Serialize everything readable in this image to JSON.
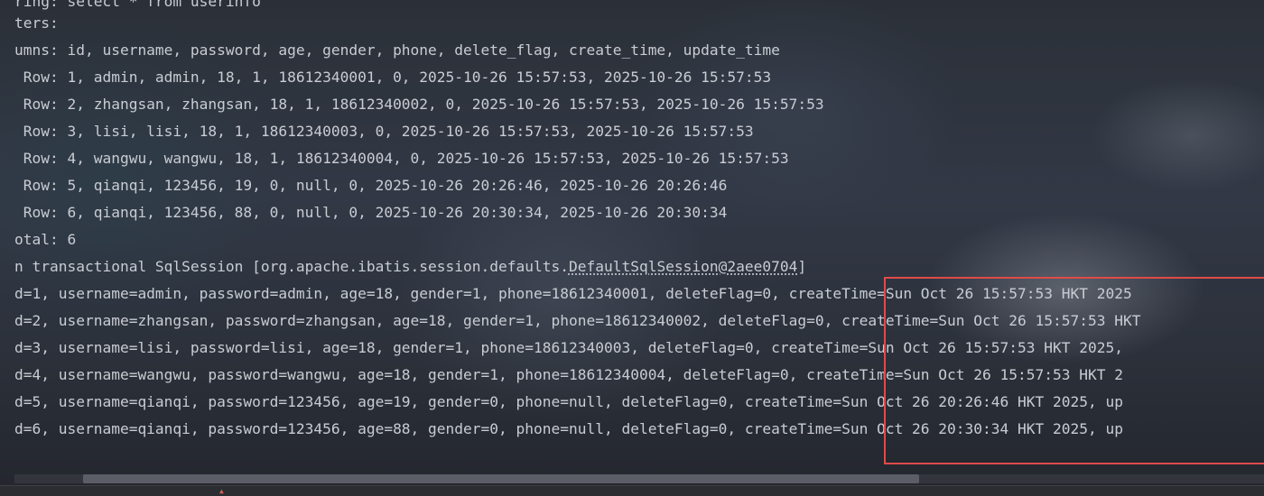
{
  "console": {
    "lines": [
      "ring: select * from userinfo",
      "ters:",
      "umns: id, username, password, age, gender, phone, delete_flag, create_time, update_time",
      " Row: 1, admin, admin, 18, 1, 18612340001, 0, 2025-10-26 15:57:53, 2025-10-26 15:57:53",
      " Row: 2, zhangsan, zhangsan, 18, 1, 18612340002, 0, 2025-10-26 15:57:53, 2025-10-26 15:57:53",
      " Row: 3, lisi, lisi, 18, 1, 18612340003, 0, 2025-10-26 15:57:53, 2025-10-26 15:57:53",
      " Row: 4, wangwu, wangwu, 18, 1, 18612340004, 0, 2025-10-26 15:57:53, 2025-10-26 15:57:53",
      " Row: 5, qianqi, 123456, 19, 0, null, 0, 2025-10-26 20:26:46, 2025-10-26 20:26:46",
      " Row: 6, qianqi, 123456, 88, 0, null, 0, 2025-10-26 20:30:34, 2025-10-26 20:30:34",
      "otal: 6"
    ],
    "session_line": {
      "prefix": "n transactional SqlSession [org.apache.ibatis.session.defaults.",
      "link": "DefaultSqlSession@2aee0704",
      "suffix": "]"
    },
    "result_lines": [
      "d=1, username=admin, password=admin, age=18, gender=1, phone=18612340001, deleteFlag=0, createTime=Sun Oct 26 15:57:53 HKT 2025",
      "d=2, username=zhangsan, password=zhangsan, age=18, gender=1, phone=18612340002, deleteFlag=0, createTime=Sun Oct 26 15:57:53 HKT",
      "d=3, username=lisi, password=lisi, age=18, gender=1, phone=18612340003, deleteFlag=0, createTime=Sun Oct 26 15:57:53 HKT 2025,",
      "d=4, username=wangwu, password=wangwu, age=18, gender=1, phone=18612340004, deleteFlag=0, createTime=Sun Oct 26 15:57:53 HKT 2",
      "d=5, username=qianqi, password=123456, age=19, gender=0, phone=null, deleteFlag=0, createTime=Sun Oct 26 20:26:46 HKT 2025, up",
      "d=6, username=qianqi, password=123456, age=88, gender=0, phone=null, deleteFlag=0, createTime=Sun Oct 26 20:30:34 HKT 2025, up"
    ]
  },
  "colors": {
    "text": "#c9ccd3",
    "highlight_border": "#e04a4a"
  }
}
